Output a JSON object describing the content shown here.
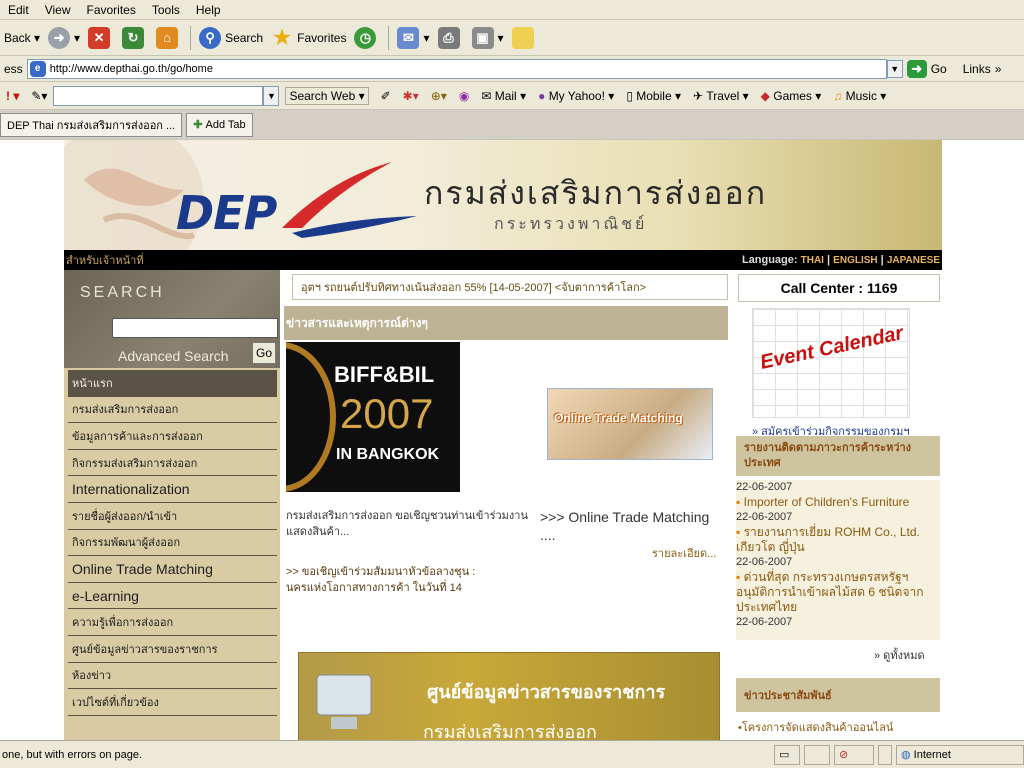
{
  "menubar": [
    "Edit",
    "View",
    "Favorites",
    "Tools",
    "Help"
  ],
  "toolbar": {
    "back": "Back",
    "search": "Search",
    "favorites": "Favorites"
  },
  "address": {
    "label": "ess",
    "url": "http://www.depthai.go.th/go/home",
    "go": "Go",
    "links": "Links"
  },
  "yahoo": {
    "search_web": "Search Web",
    "mail": "Mail",
    "my_yahoo": "My Yahoo!",
    "mobile": "Mobile",
    "travel": "Travel",
    "games": "Games",
    "music": "Music"
  },
  "tabs": {
    "current": "DEP Thai กรมส่งเสริมการส่งออก ...",
    "add": "Add Tab"
  },
  "banner": {
    "logo": "DEP",
    "title_th": "กรมส่งเสริมการส่งออก",
    "subtitle_th": "กระทรวงพาณิชย์"
  },
  "topbar": {
    "left": "สำหรับเจ้าหน้าที่",
    "language_label": "Language:",
    "lang_thai": "THAI",
    "lang_english": "ENGLISH",
    "lang_japanese": "JAPANESE"
  },
  "search": {
    "title": "SEARCH",
    "advanced": "Advanced Search",
    "go": "Go"
  },
  "leftmenu": [
    {
      "label": "หน้าแรก",
      "big": false,
      "active": true
    },
    {
      "label": "กรมส่งเสริมการส่งออก",
      "big": false,
      "active": false
    },
    {
      "label": "ข้อมูลการค้าและการส่งออก",
      "big": false,
      "active": false
    },
    {
      "label": "กิจกรรมส่งเสริมการส่งออก",
      "big": false,
      "active": false
    },
    {
      "label": "Internationalization",
      "big": true,
      "active": false
    },
    {
      "label": "รายชื่อผู้ส่งออก/นำเข้า",
      "big": false,
      "active": false
    },
    {
      "label": "กิจกรรมพัฒนาผู้ส่งออก",
      "big": false,
      "active": false
    },
    {
      "label": "Online Trade Matching",
      "big": true,
      "active": false
    },
    {
      "label": "e-Learning",
      "big": true,
      "active": false
    },
    {
      "label": "ความรู้เพื่อการส่งออก",
      "big": false,
      "active": false
    },
    {
      "label": "ศูนย์ข้อมูลข่าวสารของราชการ",
      "big": false,
      "active": false
    },
    {
      "label": "ห้องข่าว",
      "big": false,
      "active": false
    },
    {
      "label": "เวปไซต์ที่เกี่ยวข้อง",
      "big": false,
      "active": false
    }
  ],
  "center": {
    "ticker": "อุตฯ รถยนต์ปรับทิศทางเน้นส่งออก 55% [14-05-2007] <จับตาการค้าโลก>",
    "news_header": "ข่าวสารและเหตุการณ์ต่างๆ",
    "biff_line1": "BIFF&BIL",
    "biff_line2": "2007",
    "biff_line3": "IN BANGKOK",
    "otm_label": "Online Trade Matching",
    "caption1": "กรมส่งเสริมการส่งออก ขอเชิญชวนท่านเข้าร่วมงานแสดงสินค้า...",
    "caption2": ">>> Online Trade Matching ....",
    "more": "รายละเอียด...",
    "caption3": ">> ขอเชิญเข้าร่วมสัมมนาหัวข้อลางชุน : นครแห่งโอกาสทางการค้า ในวันที่ 14",
    "gov_line1": "ศูนย์ข้อมูลข่าวสารของราชการ",
    "gov_line2": "กรมส่งเสริมการส่งออก"
  },
  "right": {
    "call_center": "Call Center : 1169",
    "event_calendar": "Event Calendar",
    "register_link": "» สมัครเข้าร่วมกิจกรรมของกรมฯ",
    "report_header": "รายงานติดตามภาวะการค้าระหว่างประเทศ",
    "news": [
      {
        "date": "22-06-2007",
        "title": "Importer of Children's Furniture"
      },
      {
        "date": "22-06-2007",
        "title": "รายงานการเยี่ยม ROHM Co., Ltd. เกียวโต ญี่ปุ่น"
      },
      {
        "date": "22-06-2007",
        "title": "ด่วนที่สุด กระทรวงเกษตรสหรัฐฯ อนุมัติการนำเข้าผลไม้สด 6 ชนิดจากประเทศไทย"
      },
      {
        "date": "22-06-2007",
        "title": ""
      }
    ],
    "all_news": "» ดูทั้งหมด",
    "pr_header": "ข่าวประชาสัมพันธ์",
    "pr_item": "•โครงการจัดแสดงสินค้าออนไลน์"
  },
  "status": {
    "text": "one, but with errors on page.",
    "zone": "Internet"
  }
}
